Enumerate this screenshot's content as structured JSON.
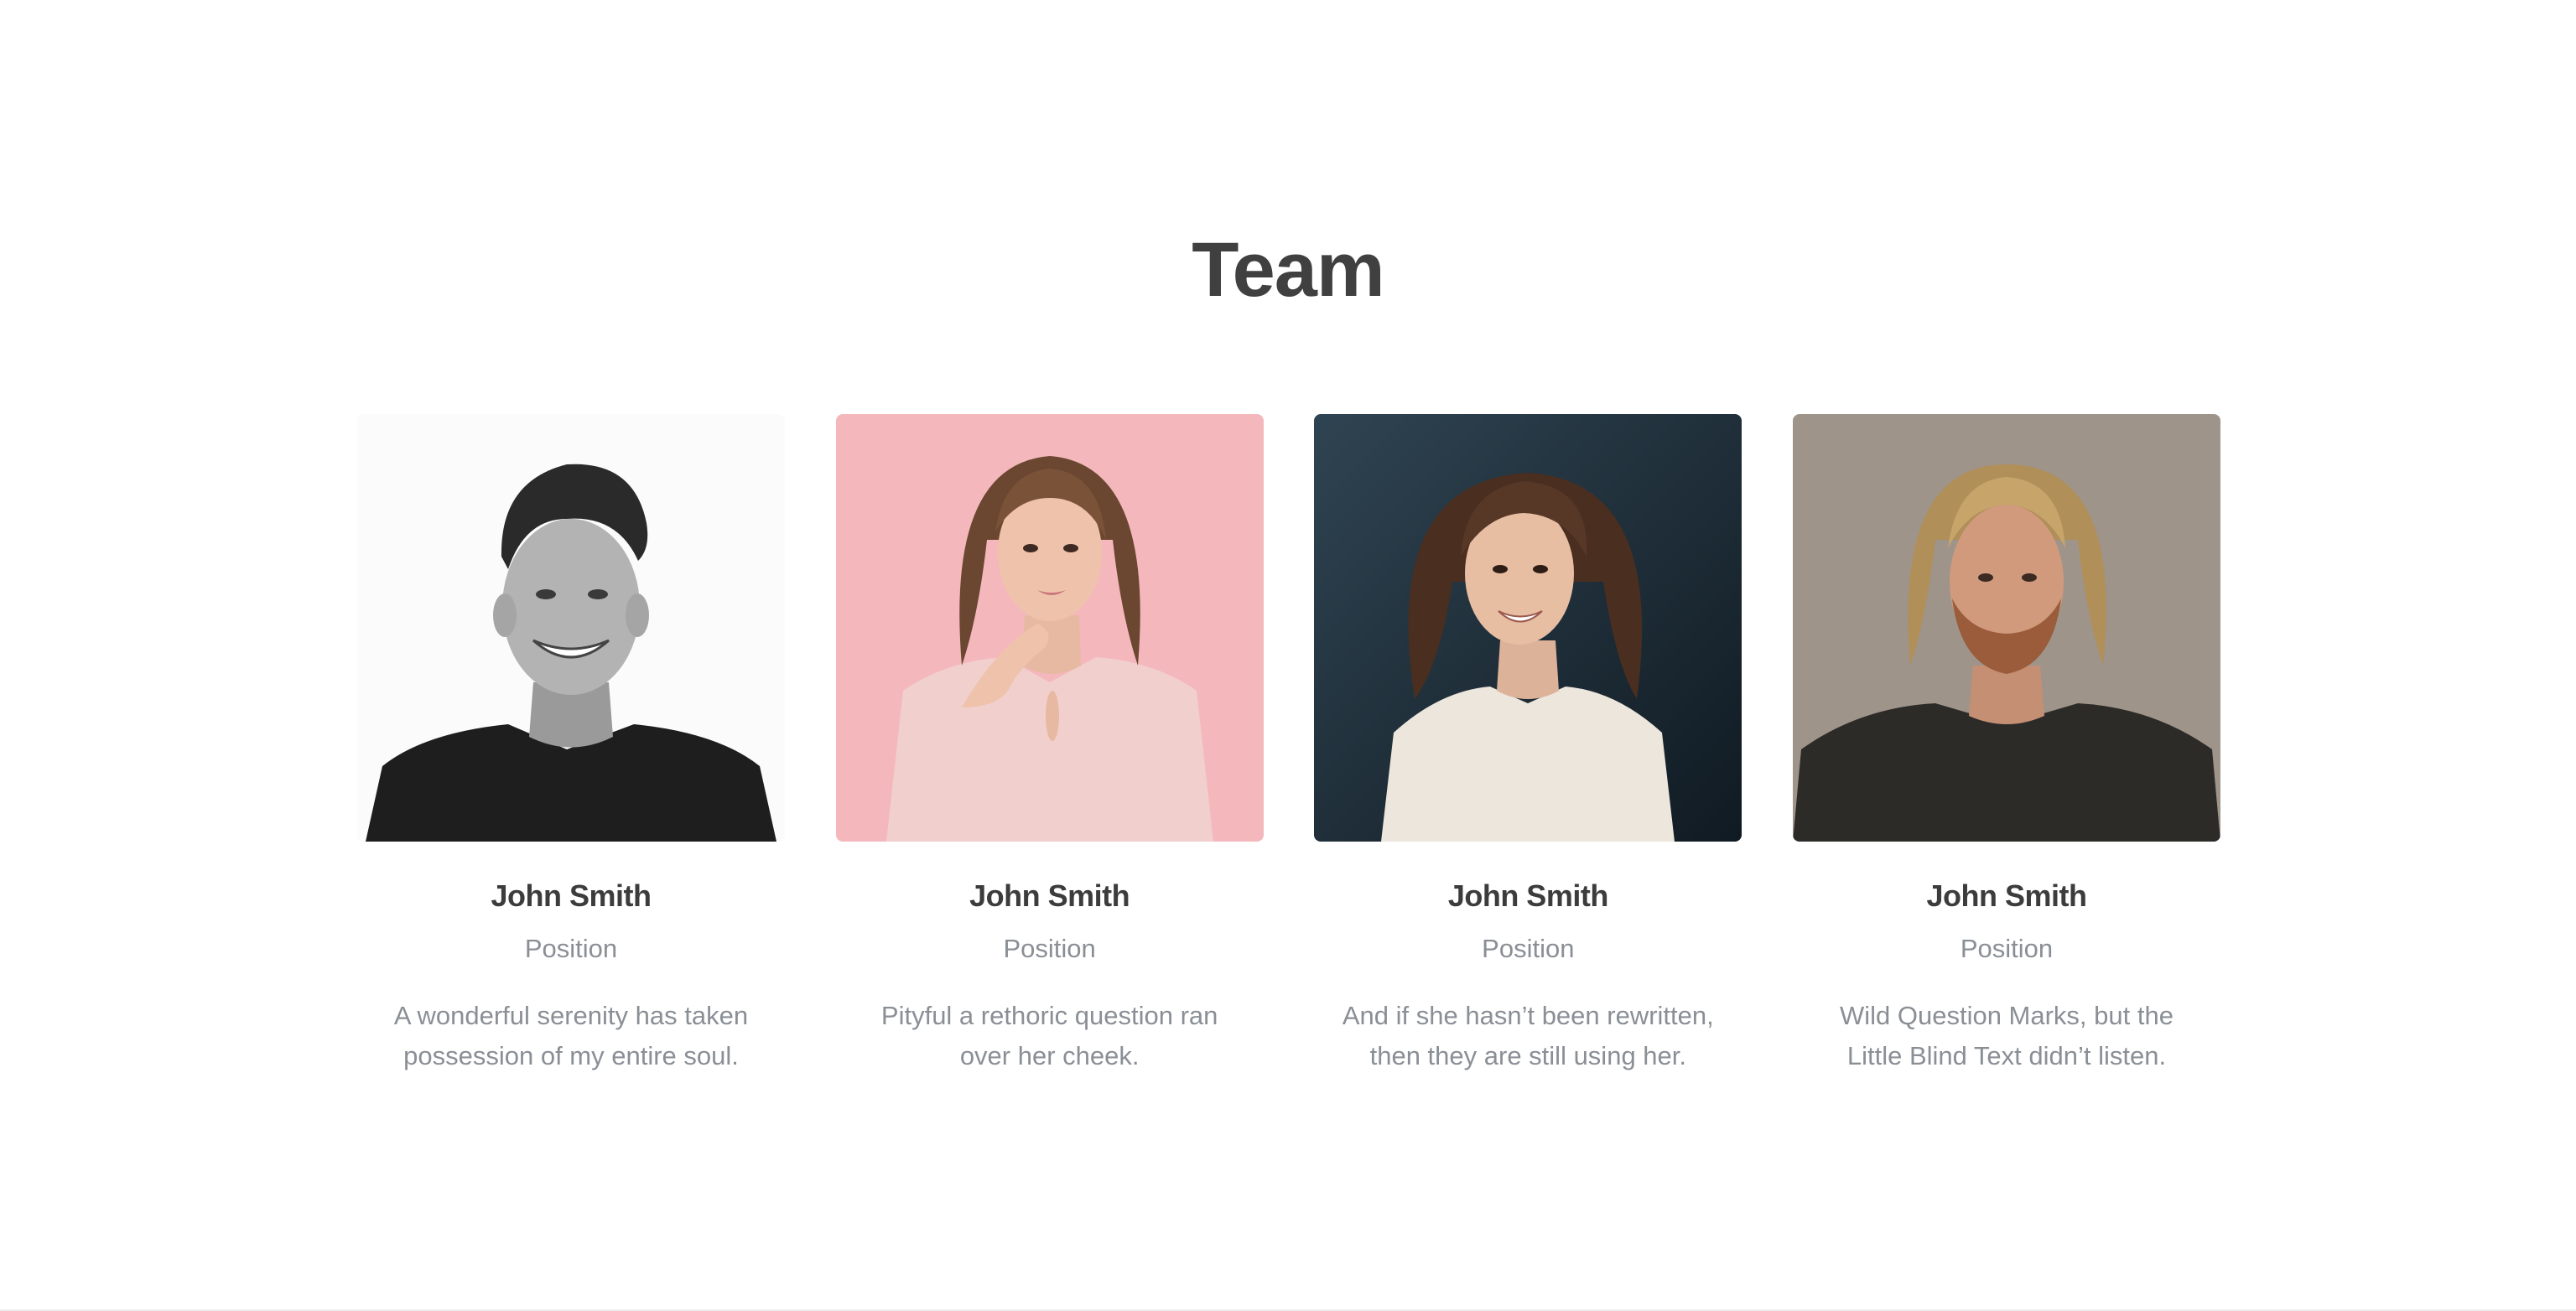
{
  "section": {
    "title": "Team"
  },
  "members": [
    {
      "name": "John Smith",
      "position": "Position",
      "description": "A wonderful serenity has taken possession of my entire soul.",
      "photo": "portrait-young-man-bw-photo"
    },
    {
      "name": "John Smith",
      "position": "Position",
      "description": "Pityful a rethoric question ran over her cheek.",
      "photo": "portrait-woman-pink-background-photo"
    },
    {
      "name": "John Smith",
      "position": "Position",
      "description": "And if she hasn’t been rewritten, then they are still using her.",
      "photo": "portrait-woman-dark-background-photo"
    },
    {
      "name": "John Smith",
      "position": "Position",
      "description": "Wild Question Marks, but the Little Blind Text didn’t listen.",
      "photo": "portrait-bearded-man-stone-background-photo"
    }
  ],
  "colors": {
    "heading": "#404040",
    "name": "#3c3c3c",
    "muted": "#8a8f96",
    "background": "#ffffff"
  }
}
